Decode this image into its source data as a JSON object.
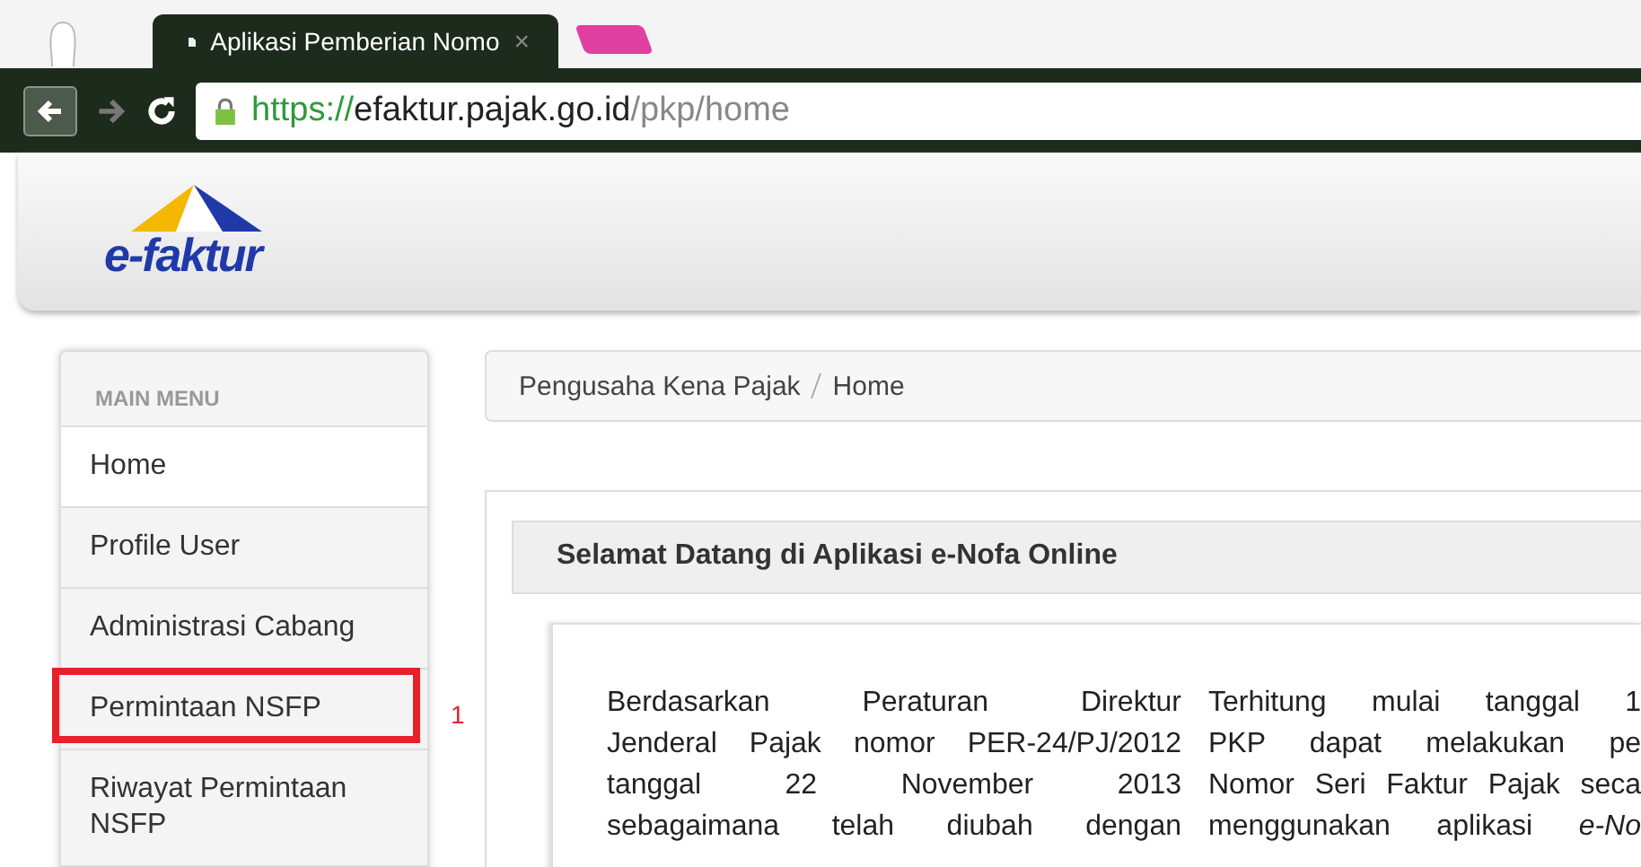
{
  "browser": {
    "tab": {
      "title": "Aplikasi Pemberian Nomo",
      "close": "×"
    },
    "url": {
      "scheme": "https://",
      "host": "efaktur.pajak.go.id",
      "path": "/pkp/home"
    }
  },
  "header": {
    "logo": "e-faktur"
  },
  "sidebar": {
    "title": "MAIN MENU",
    "items": [
      {
        "label": "Home",
        "selected": true,
        "highlighted": false
      },
      {
        "label": "Profile User",
        "selected": false,
        "highlighted": false
      },
      {
        "label": "Administrasi Cabang",
        "selected": false,
        "highlighted": false
      },
      {
        "label": "Permintaan NSFP",
        "selected": false,
        "highlighted": true,
        "callout": "1"
      },
      {
        "label": "Riwayat Permintaan NSFP",
        "selected": false,
        "highlighted": false
      }
    ]
  },
  "breadcrumb": [
    "Pengusaha Kena Pajak",
    "Home"
  ],
  "panel": {
    "title": "Selamat Datang di Aplikasi e-Nofa Online",
    "columns": [
      [
        "Berdasarkan Peraturan Direktur",
        "Jenderal Pajak nomor PER-24/PJ/2012",
        "tanggal 22 November 2013",
        "sebagaimana telah diubah dengan"
      ],
      [
        "Terhitung mulai tanggal 1",
        "PKP dapat melakukan pe",
        "Nomor Seri Faktur Pajak seca",
        "menggunakan aplikasi *e-No*"
      ]
    ]
  }
}
